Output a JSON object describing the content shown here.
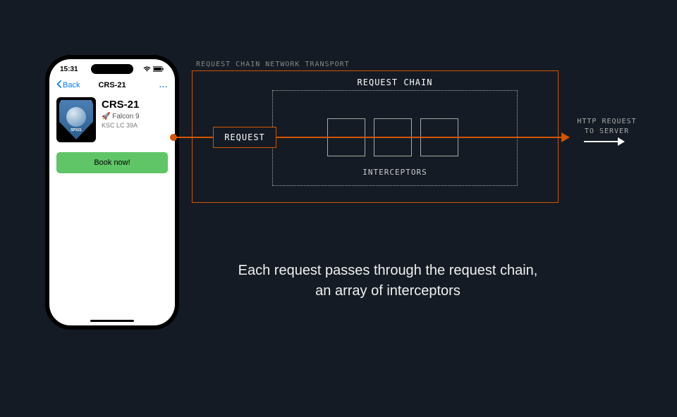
{
  "phone": {
    "time": "15:31",
    "nav": {
      "back_label": "Back",
      "title": "CRS-21",
      "menu_dots": "..."
    },
    "badge_text": "SPX21",
    "mission": {
      "name": "CRS-21",
      "rocket_emoji": "🚀",
      "rocket_name": "Falcon 9",
      "launch_site": "KSC LC 39A"
    },
    "book_button_label": "Book now!"
  },
  "diagram": {
    "outer_box_label": "REQUEST CHAIN NETWORK TRANSPORT",
    "request_label": "REQUEST",
    "chain_label": "REQUEST CHAIN",
    "interceptors_label": "INTERCEPTORS",
    "http_line1": "HTTP REQUEST",
    "http_line2": "TO SERVER",
    "interceptor_count": 3,
    "colors": {
      "accent": "#d35400",
      "border": "#aaa",
      "bg": "#141b24"
    }
  },
  "caption": {
    "line1": "Each request passes through the request chain,",
    "line2": "an array of interceptors"
  }
}
